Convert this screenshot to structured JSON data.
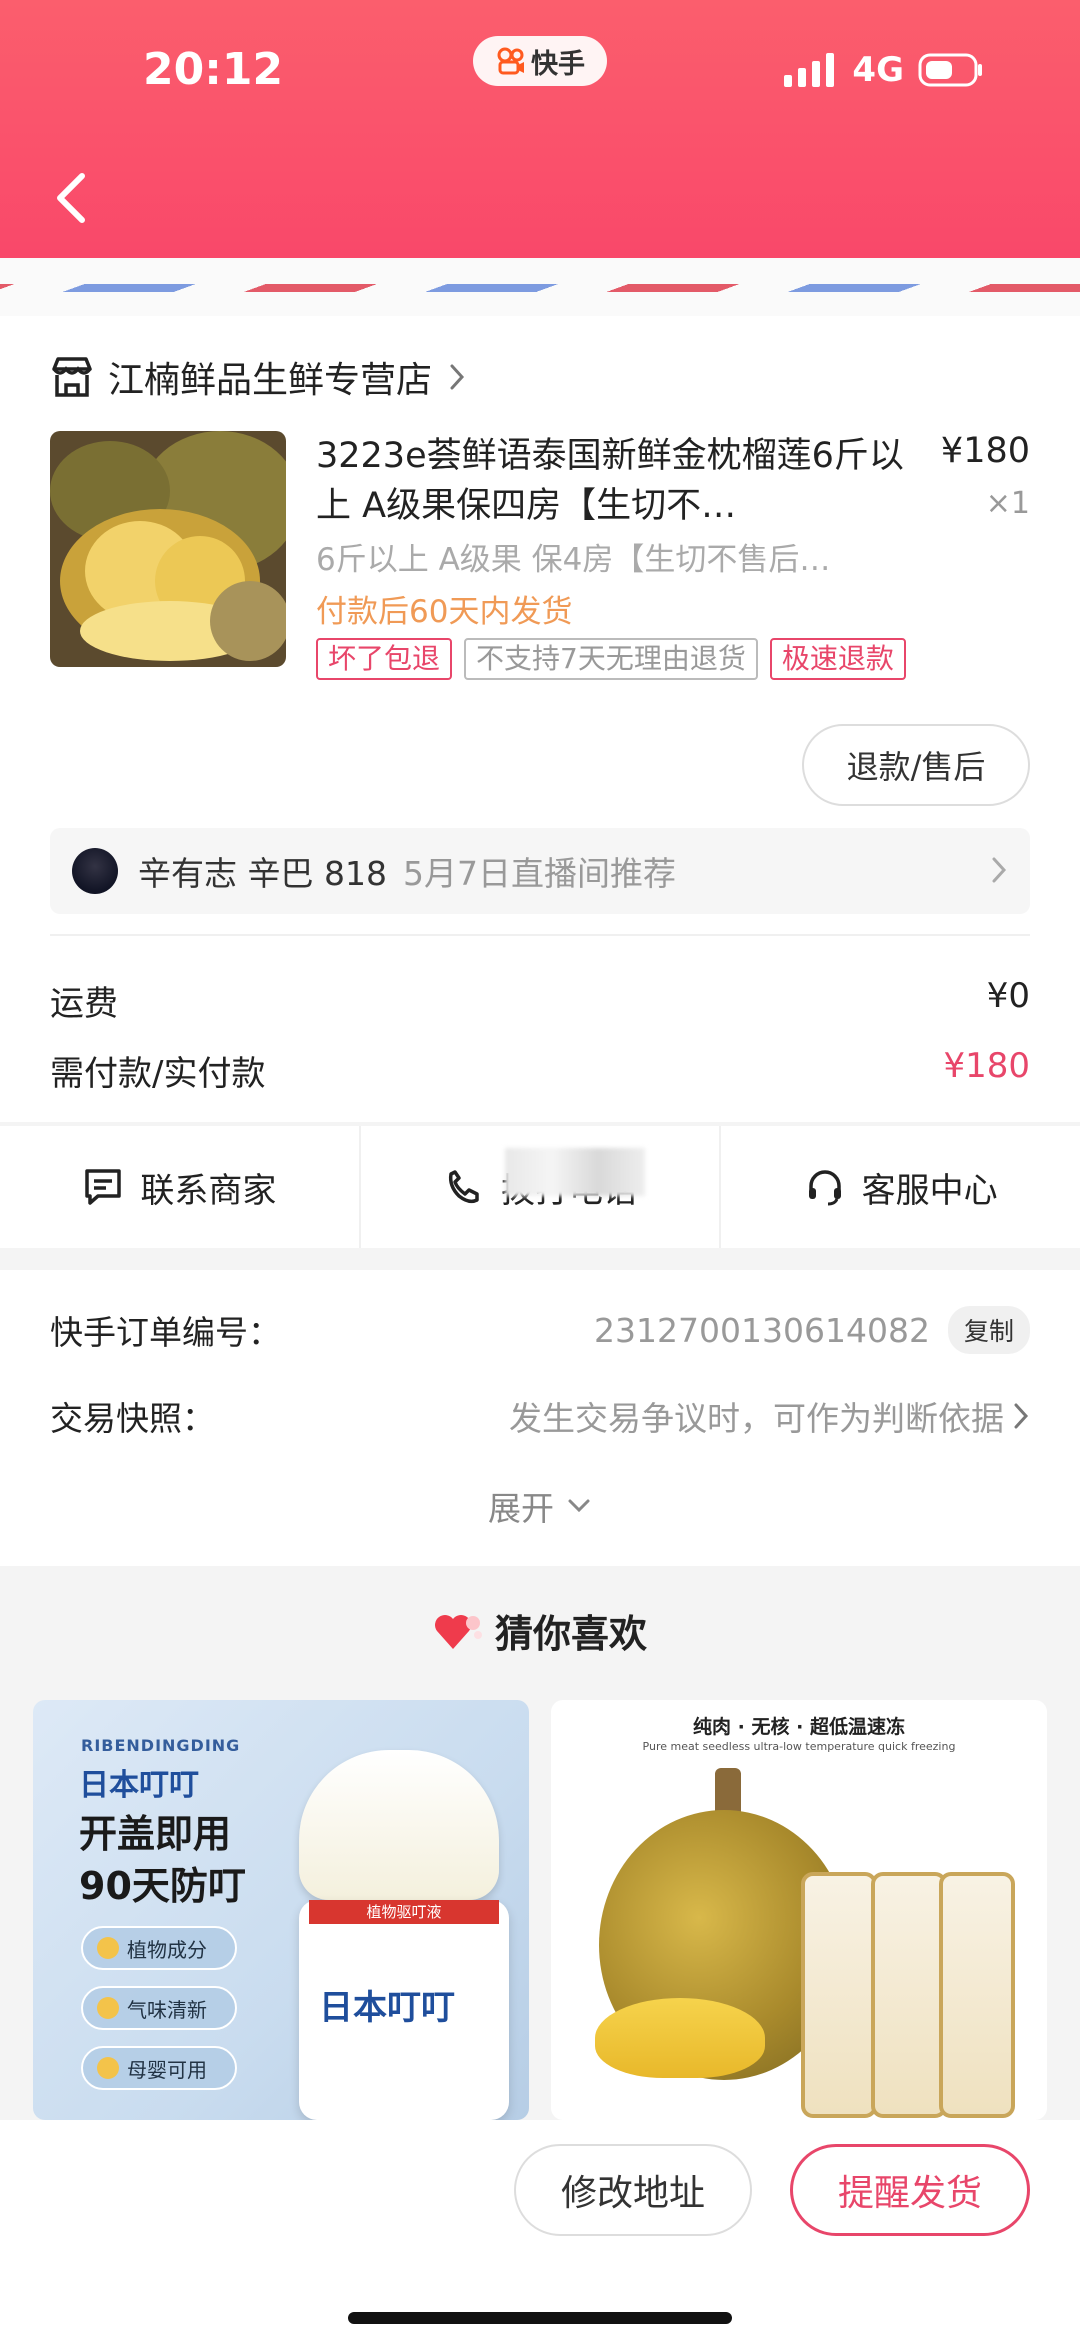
{
  "status_bar": {
    "time": "20:12",
    "app_badge": "快手",
    "network": "4G"
  },
  "store": {
    "name": "江楠鲜品生鲜专营店"
  },
  "product": {
    "title": "3223e荟鲜语泰国新鲜金枕榴莲6斤以上 A级果保四房【生切不…",
    "price": "¥180",
    "qty": "×1",
    "spec": "6斤以上 A级果 保4房【生切不售后…",
    "ship_note": "付款后60天内发货",
    "tags": [
      "坏了包退",
      "不支持7天无理由退货",
      "极速退款"
    ]
  },
  "refund_button": "退款/售后",
  "live": {
    "anchor": "辛有志 辛巴 818",
    "desc": "5月7日直播间推荐"
  },
  "fees": {
    "shipping_label": "运费",
    "shipping_value": "¥0",
    "pay_label": "需付款/实付款",
    "pay_value": "¥180"
  },
  "actions": {
    "contact": "联系商家",
    "call": "拨打电话",
    "service": "客服中心"
  },
  "order": {
    "no_label": "快手订单编号：",
    "no_value": "2312700130614082",
    "copy": "复制",
    "snapshot_label": "交易快照：",
    "snapshot_desc": "发生交易争议时，可作为判断依据",
    "expand": "展开"
  },
  "recommend": {
    "title": "猜你喜欢",
    "item1": {
      "brand_en": "RIBENDINGDING",
      "brand": "日本叮叮",
      "slogan1": "开盖即用",
      "slogan2": "90天防叮",
      "features": [
        "植物成分",
        "气味清新",
        "母婴可用"
      ],
      "jar_label": "日本叮叮",
      "jar_sub": "植物驱叮液"
    },
    "item2": {
      "headline": "纯肉 · 无核 · 超低温速冻",
      "subline": "Pure meat seedless ultra-low temperature quick freezing"
    }
  },
  "bottom": {
    "edit_address": "修改地址",
    "remind_ship": "提醒发货"
  },
  "colors": {
    "accent": "#e8466a",
    "header": "#f9486a",
    "ship_note": "#f09a56"
  }
}
